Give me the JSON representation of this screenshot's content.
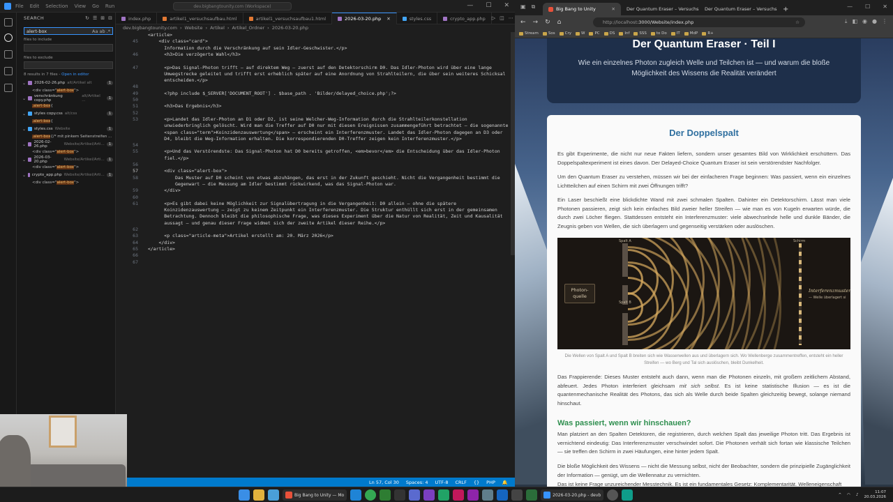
{
  "vscode": {
    "menu": [
      "File",
      "Edit",
      "Selection",
      "View",
      "Go",
      "Run"
    ],
    "command_center": "dev.bigbangtounity.com (Workspace)",
    "sidebar": {
      "title": "SEARCH",
      "search_value": "alert-box",
      "files_include_label": "files to include",
      "files_exclude_label": "files to exclude",
      "summary": "8 results in 7 files -",
      "open_in_editor": "Open in editor",
      "results": [
        {
          "file": "2026-02-26.php",
          "path": "alt/Artikel alt",
          "count": "1",
          "line_pre": "<div class=\"",
          "line_hl": "alert-box",
          "line_post": "\">"
        },
        {
          "file": "verschränkung copy.php",
          "path": "alt/Artikel ...",
          "count": "1",
          "line_pre": "",
          "line_hl": ".alert-box",
          "line_post": " {"
        },
        {
          "file": "styles copy.css",
          "path": "alt/css",
          "count": "1",
          "line_pre": "",
          "line_hl": ".alert-box",
          "line_post": " {"
        },
        {
          "file": "styles.css",
          "path": "Website",
          "count": "1",
          "line_pre": "",
          "line_hl": ".alert-box",
          "line_post": " {/* mit pinkem Seitenstreifen ..."
        },
        {
          "file": "2026-02-26.php",
          "path": "Website/Artikel/Arti...",
          "count": "1",
          "line_pre": "<div class=\"",
          "line_hl": "alert-box",
          "line_post": "\">"
        },
        {
          "file": "2026-03-20.php",
          "path": "Website/Artikel/Arti...",
          "count": "1",
          "line_pre": "<div class=\"",
          "line_hl": "alert-box",
          "line_post": "\">"
        },
        {
          "file": "crypto_app.php",
          "path": "Website/Artikel/Arti...",
          "count": "1",
          "line_pre": "<div class=\"",
          "line_hl": "alert-box",
          "line_post": "\">"
        }
      ]
    },
    "tabs": [
      {
        "label": "index.php",
        "type": "php"
      },
      {
        "label": "artikel1_versuchsaufbau.html",
        "type": "html"
      },
      {
        "label": "artikel1_versuchsaufbau1.html",
        "type": "html"
      },
      {
        "label": "2026-03-20.php",
        "type": "php"
      },
      {
        "label": "styles.css",
        "type": "css"
      },
      {
        "label": "crypto_app.php",
        "type": "php"
      }
    ],
    "active_tab": "2026-03-20.php",
    "breadcrumbs": [
      "dev.bigbangtounity.com",
      "Website",
      "Artikel",
      "Artikel_Ordner",
      "2026-03-20.php"
    ],
    "code_lines": [
      {
        "n": "",
        "t": "  <article>"
      },
      {
        "n": "45",
        "t": "      <div class=\"card\">"
      },
      {
        "n": "",
        "t": "        Information durch die Verschränkung auf sein Idler-Geschwister.</p>"
      },
      {
        "n": "46",
        "t": "        <h3>Die verzögerte Wahl</h3>"
      },
      {
        "n": "",
        "t": ""
      },
      {
        "n": "47",
        "t": "        <p>Das Signal-Photon trifft – auf direktem Weg – zuerst auf den Detektorschirm D0. Das Idler-Photon wird über eine lange"
      },
      {
        "n": "",
        "t": "        Umwegstrecke geleitet und trifft erst erheblich später auf eine Anordnung von Strahlteilern, die über sein weiteres Schicksal"
      },
      {
        "n": "",
        "t": "        entscheiden.</p>"
      },
      {
        "n": "48",
        "t": ""
      },
      {
        "n": "49",
        "t": "        <?php include $_SERVER['DOCUMENT_ROOT'] . $base_path . 'Bilder/delayed_choice.php';?>"
      },
      {
        "n": "50",
        "t": ""
      },
      {
        "n": "51",
        "t": "        <h3>Das Ergebnis</h3>"
      },
      {
        "n": "52",
        "t": ""
      },
      {
        "n": "53",
        "t": "        <p>Landet das Idler-Photon an D1 oder D2, ist seine Welcher-Weg-Information durch die Strahlteilerkonstellation"
      },
      {
        "n": "",
        "t": "        unwiederbringlich gelöscht. Wird man die Treffer auf D0 nur mit diesen Ereignissen zusammengeführt betrachtet – die sogenannte"
      },
      {
        "n": "",
        "t": "        <span class=\"term\">Koinzidenzauswertung</span> – erscheint ein Interferenzmuster. Landet das Idler-Photon dagegen an D3 oder"
      },
      {
        "n": "",
        "t": "        D4, bleibt die Weg-Information erhalten. Die korrespondierenden D0-Treffer zeigen kein Interferenzmuster.</p>"
      },
      {
        "n": "54",
        "t": ""
      },
      {
        "n": "55",
        "t": "        <p>Und das Verstörendste: Das Signal-Photon hat D0 bereits getroffen, <em>bevor</em> die Entscheidung über das Idler-Photon"
      },
      {
        "n": "",
        "t": "        fiel.</p>"
      },
      {
        "n": "56",
        "t": ""
      },
      {
        "n": "57",
        "t": "        <div class=\"alert-box\">"
      },
      {
        "n": "58",
        "t": "            Das Muster auf D0 scheint von etwas abzuhängen, das erst in der Zukunft geschieht. Nicht die Vergangenheit bestimmt die"
      },
      {
        "n": "",
        "t": "            Gegenwart – die Messung am Idler bestimmt rückwirkend, was das Signal-Photon war."
      },
      {
        "n": "59",
        "t": "        </div>"
      },
      {
        "n": "60",
        "t": ""
      },
      {
        "n": "61",
        "t": "        <p>Es gibt dabei keine Möglichkeit zur Signalübertragung in die Vergangenheit: D0 allein – ohne die spätere"
      },
      {
        "n": "",
        "t": "        Koinzidenzauswertung – zeigt zu keinem Zeitpunkt ein Interferenzmuster. Die Struktur enthüllt sich erst in der gemeinsamen"
      },
      {
        "n": "",
        "t": "        Betrachtung. Dennoch bleibt die philosophische Frage, was dieses Experiment über die Natur von Realität, Zeit und Kausalität"
      },
      {
        "n": "",
        "t": "        aussagt – und genau dieser Frage widmet sich der zweite Artikel dieser Reihe.</p>"
      },
      {
        "n": "62",
        "t": ""
      },
      {
        "n": "63",
        "t": "        <p class=\"article-meta\">Artikel erstellt am: 20. März 2026</p>"
      },
      {
        "n": "64",
        "t": "      </div>"
      },
      {
        "n": "65",
        "t": "  </article>"
      },
      {
        "n": "66",
        "t": ""
      },
      {
        "n": "67",
        "t": ""
      }
    ],
    "status": {
      "position": "Ln 57, Col 30",
      "spaces": "Spaces: 4",
      "encoding": "UTF-8",
      "eol": "CRLF",
      "lang_braces": "{}",
      "language": "PHP"
    }
  },
  "browser": {
    "tabs": [
      {
        "label": "Big Bang to Unity"
      },
      {
        "label": "Der Quantum Eraser – Versuchsaufb"
      },
      {
        "label": "Der Quantum Eraser – Versuchsaufb"
      }
    ],
    "url_host": "http://localhost",
    "url_rest": ":3000/Website/index.php",
    "bookmarks": [
      "Stream",
      "Sos",
      "Cry",
      "W",
      "PC",
      "DS",
      "Inf",
      "SSS",
      "to Do",
      "IT",
      "MdP",
      "R+"
    ],
    "page": {
      "hero_title": "Der Quantum Eraser · Teil I",
      "hero_subtitle": "Wie ein einzelnes Photon zugleich Welle und Teilchen ist — und warum die bloße Möglichkeit des Wissens die Realität verändert",
      "section_title": "Der Doppelspalt",
      "p1": "Es gibt Experimente, die nicht nur neue Fakten liefern, sondern unser gesamtes Bild von Wirklichkeit erschüttern. Das Doppelspaltexperiment ist eines davon. Der Delayed-Choice Quantum Eraser ist sein verstörendster Nachfolger.",
      "p2": "Um den Quantum Eraser zu verstehen, müssen wir bei der einfacheren Frage beginnen: Was passiert, wenn ein einzelnes Lichtteilchen auf einen Schirm mit zwei Öffnungen trifft?",
      "p3": "Ein Laser beschießt eine blickdichte Wand mit zwei schmalen Spalten. Dahinter ein Detektorschirm. Lässt man viele Photonen passieren, zeigt sich kein einfaches Bild zweier heller Streifen — wie man es von Kugeln erwarten würde, die durch zwei Löcher fliegen. Stattdessen entsteht ein Interferenzmuster: viele abwechselnde helle und dunkle Bänder, die Zeugnis geben von Wellen, die sich überlagern und gegenseitig verstärken oder auslöschen.",
      "figure": {
        "source_label": "Photon-quelle",
        "slit_a": "Spalt A",
        "slit_b": "Spalt B",
        "screen_label": "Schirm",
        "pattern_label": "Interferenzmuster",
        "pattern_sub": "— Welle überlagert si"
      },
      "caption": "Die Wellen von Spalt A und Spalt B breiten sich wie Wasserwellen aus und überlagern sich. Wo Wellenberge zusammentreffen, entsteht ein heller Streifen — wo Berg und Tal sich auslöschen, bleibt Dunkelheit.",
      "p4_pre": "Das Frappierende: Dieses Muster entsteht auch dann, wenn man die Photonen einzeln, mit großem zeitlichem Abstand, abfeuert. Jedes Photon interferiert gleichsam ",
      "p4_em": "mit sich selbst",
      "p4_post": ". Es ist keine statistische Illusion — es ist die quantenmechanische Realität des Photons, das sich als Welle durch beide Spalten gleichzeitig bewegt, solange niemand hinschaut.",
      "h3": "Was passiert, wenn wir hinschauen?",
      "p5": "Man platziert an den Spalten Detektoren, die registrieren, durch welchen Spalt das jeweilige Photon tritt. Das Ergebnis ist vernichtend eindeutig: Das Interferenzmuster verschwindet sofort. Die Photonen verhält sich fortan wie klassische Teilchen — sie treffen den Schirm in zwei Häufungen, eine hinter jedem Spalt.",
      "p6": "Die bloße Möglichkeit des Wissens — nicht die Messung selbst, nicht der Beobachter, sondern die prinzipielle Zugänglichkeit der Information — genügt, um die Wellennatur zu vernichten.",
      "p7": "Das ist keine Frage unzureichender Messtechnik. Es ist ein fundamentales Gesetz: Komplementarität. Welleneigenschaft"
    }
  },
  "taskbar": {
    "apps": [
      {
        "label": "Big Bang to Unity — Mo",
        "color": "#e8513a"
      },
      {
        "label": "2026-03-20.php - devb",
        "color": "#3794ff"
      }
    ],
    "time": "11:07",
    "date": "20.03.2026"
  }
}
